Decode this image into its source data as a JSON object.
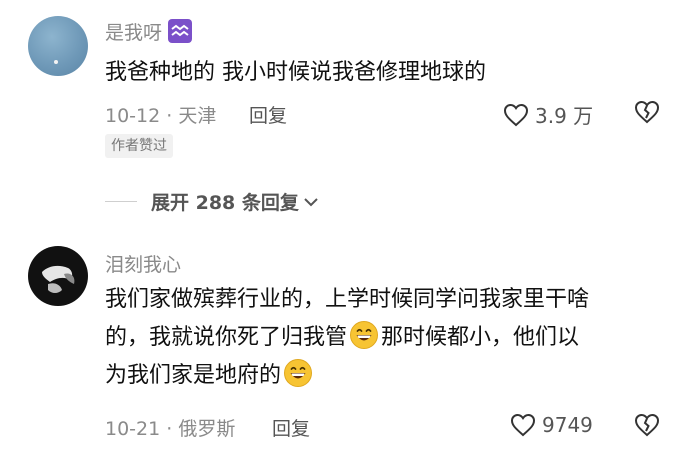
{
  "comments": [
    {
      "username": "是我呀",
      "badge_icon": "aquarius-zodiac-icon",
      "badge_color": "#7b50c9",
      "lines": [
        "我爸种地的 我小时候说我爸修理地球的"
      ],
      "date_location": "10-12 · 天津",
      "reply_label": "回复",
      "like_count": "3.9 万",
      "tag": "作者赞过",
      "expand_label": "展开 288 条回复"
    },
    {
      "username": "泪刻我心",
      "line1": "我们家做殡葬行业的，上学时候同学问我家里干啥",
      "line2_a": "的，我就说你死了归我管",
      "line2_b": "那时候都小，他们以",
      "line3": "为我们家是地府的",
      "emoji_icon": "grinning-face-emoji",
      "date_location": "10-21 · 俄罗斯",
      "reply_label": "回复",
      "like_count": "9749"
    }
  ]
}
